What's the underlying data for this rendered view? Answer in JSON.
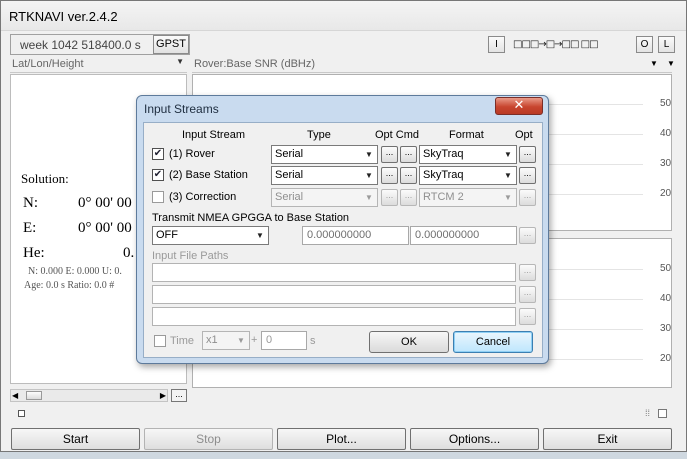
{
  "app": {
    "title": "RTKNAVI ver.2.4.2",
    "time_display": "week 1042 518400.0 s",
    "time_system_button": "GPST",
    "input_button": "I",
    "stream_flow": "□□□→□→□□ □□",
    "output_button": "O",
    "log_button": "L"
  },
  "left_panel": {
    "mode_select": "Lat/Lon/Height",
    "solution_label": "Solution:",
    "north_label": "N:",
    "north_value": "0° 00' 00",
    "east_label": "E:",
    "east_value": "0° 00' 00",
    "height_label": "He:",
    "height_value": "0.",
    "std_line": "N: 0.000 E: 0.000 U: 0.",
    "age_line": "Age: 0.0 s Ratio: 0.0 #",
    "more_button": "..."
  },
  "right_panel": {
    "plot_select": "Rover:Base SNR (dBHz)",
    "top_plot_ticks": [
      "50",
      "40",
      "30",
      "20"
    ],
    "bottom_plot_ticks": [
      "50",
      "40",
      "30",
      "20"
    ]
  },
  "bottom_buttons": {
    "start": "Start",
    "stop": "Stop",
    "plot": "Plot...",
    "options": "Options...",
    "exit": "Exit"
  },
  "dialog": {
    "title": "Input Streams",
    "close_label": "✕",
    "headers": {
      "input_stream": "Input Stream",
      "type": "Type",
      "opt_cmd": "Opt Cmd",
      "format": "Format",
      "opt": "Opt"
    },
    "rows": [
      {
        "checked": "✔",
        "label": "(1) Rover",
        "type": "Serial",
        "format": "SkyTraq",
        "opt_btn": "...",
        "cmd_btn": "...",
        "fmt_opt_btn": "..."
      },
      {
        "checked": "✔",
        "label": "(2) Base Station",
        "type": "Serial",
        "format": "SkyTraq",
        "opt_btn": "...",
        "cmd_btn": "...",
        "fmt_opt_btn": "..."
      },
      {
        "checked": "",
        "label": "(3) Correction",
        "type": "Serial",
        "format": "RTCM 2",
        "opt_btn": "...",
        "cmd_btn": "...",
        "fmt_opt_btn": "..."
      }
    ],
    "nmea_label": "Transmit NMEA GPGGA to Base Station",
    "nmea_mode": "OFF",
    "nmea_lat": "0.000000000",
    "nmea_lon": "0.000000000",
    "nmea_btn": "...",
    "input_paths_label": "Input File Paths",
    "path_btn": "...",
    "time_label": "Time",
    "time_speed": "x1",
    "time_plus": "+",
    "time_offset": "0",
    "time_unit": "s",
    "ok": "OK",
    "cancel": "Cancel"
  }
}
